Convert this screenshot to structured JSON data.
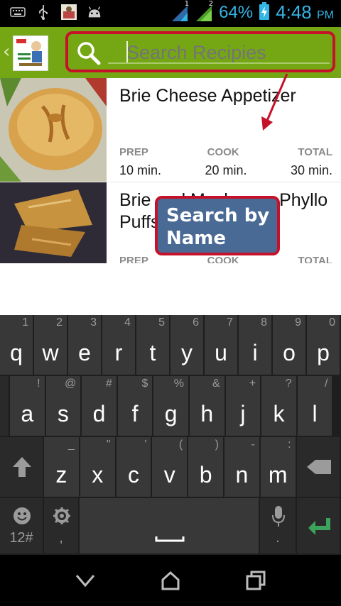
{
  "status_bar": {
    "battery_percent": "64%",
    "time": "4:48",
    "ampm": "PM",
    "icons": [
      "keyboard-icon",
      "usb-icon",
      "app-thumbnail-icon",
      "android-icon",
      "signal-1-icon",
      "signal-2-icon",
      "battery-charging-icon"
    ],
    "sim_labels": [
      "1",
      "2"
    ]
  },
  "action_bar": {
    "back_glyph": "‹",
    "search_placeholder": "Search Recipies",
    "search_value": "",
    "logo_alt": "app-logo"
  },
  "recipes": [
    {
      "title": "Brie Cheese Appetizer",
      "meta_labels": [
        "PREP",
        "COOK",
        "TOTAL"
      ],
      "meta_values": [
        "10 min.",
        "20 min.",
        "30 min."
      ]
    },
    {
      "title": "Brie and Mushroom Phyllo Puffs",
      "meta_labels": [
        "PREP",
        "COOK",
        "TOTAL"
      ],
      "meta_values": []
    }
  ],
  "callout": {
    "text": "Search by Name"
  },
  "keyboard": {
    "row1": [
      {
        "main": "q",
        "hint": "1"
      },
      {
        "main": "w",
        "hint": "2"
      },
      {
        "main": "e",
        "hint": "3"
      },
      {
        "main": "r",
        "hint": "4"
      },
      {
        "main": "t",
        "hint": "5"
      },
      {
        "main": "y",
        "hint": "6"
      },
      {
        "main": "u",
        "hint": "7"
      },
      {
        "main": "i",
        "hint": "8"
      },
      {
        "main": "o",
        "hint": "9"
      },
      {
        "main": "p",
        "hint": "0"
      }
    ],
    "row2": [
      {
        "main": "a",
        "hint": "!"
      },
      {
        "main": "s",
        "hint": "@"
      },
      {
        "main": "d",
        "hint": "#"
      },
      {
        "main": "f",
        "hint": "$"
      },
      {
        "main": "g",
        "hint": "%"
      },
      {
        "main": "h",
        "hint": "&"
      },
      {
        "main": "j",
        "hint": "+"
      },
      {
        "main": "k",
        "hint": "?"
      },
      {
        "main": "l",
        "hint": "/"
      }
    ],
    "row3": [
      {
        "main": "z",
        "hint": "_"
      },
      {
        "main": "x",
        "hint": "\""
      },
      {
        "main": "c",
        "hint": "'"
      },
      {
        "main": "v",
        "hint": "("
      },
      {
        "main": "b",
        "hint": ")"
      },
      {
        "main": "n",
        "hint": "-"
      },
      {
        "main": "m",
        "hint": ":"
      }
    ],
    "symbols_label": "12#",
    "comma_label": ",",
    "period_label": ".",
    "shift_icon": "shift-icon",
    "backspace_icon": "backspace-icon",
    "settings_icon": "gear-icon",
    "mic_icon": "microphone-icon",
    "enter_icon": "enter-icon",
    "space_icon": "space-icon"
  },
  "nav_bar": {
    "icons": [
      "back-chevron-icon",
      "home-icon",
      "recents-icon"
    ]
  },
  "colors": {
    "accent": "#75a714",
    "highlight": "#c5122a",
    "callout": "#4a6a96",
    "status": "#33b5e5"
  }
}
